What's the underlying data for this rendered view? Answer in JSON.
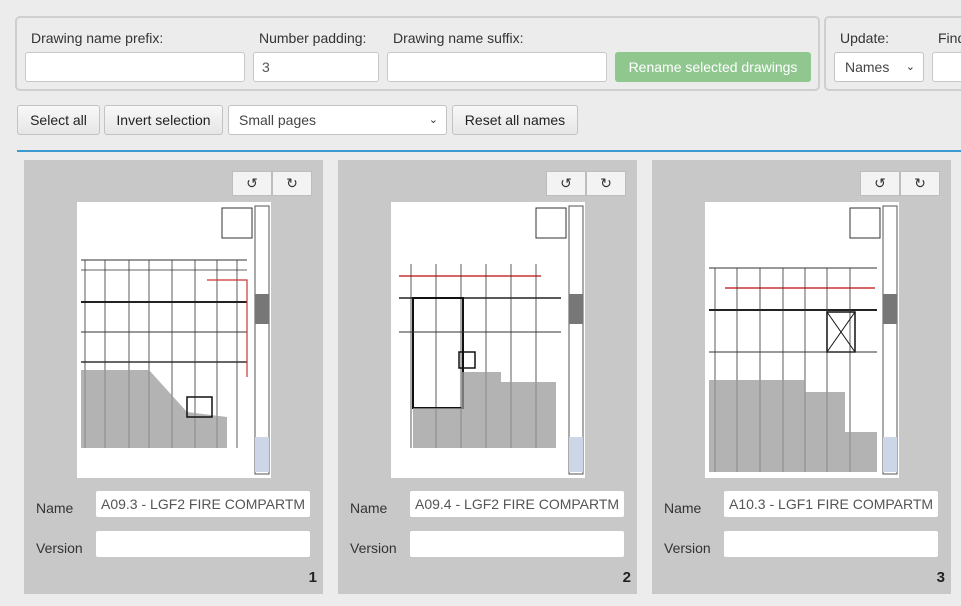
{
  "rename_panel": {
    "prefix_label": "Drawing name prefix:",
    "prefix_value": "",
    "padding_label": "Number padding:",
    "padding_value": "3",
    "suffix_label": "Drawing name suffix:",
    "suffix_value": "",
    "rename_button": "Rename selected drawings"
  },
  "update_panel": {
    "update_label": "Update:",
    "update_selected": "Names",
    "find_label": "Find",
    "find_value": ""
  },
  "toolbar": {
    "select_all": "Select all",
    "invert_selection": "Invert selection",
    "page_size_selected": "Small pages",
    "reset_names": "Reset all names"
  },
  "cards": [
    {
      "name_label": "Name",
      "name_value": "A09.3 - LGF2 FIRE COMPARTM",
      "version_label": "Version",
      "version_value": "",
      "number": "1"
    },
    {
      "name_label": "Name",
      "name_value": "A09.4 - LGF2 FIRE COMPARTM",
      "version_label": "Version",
      "version_value": "",
      "number": "2"
    },
    {
      "name_label": "Name",
      "name_value": "A10.3 - LGF1 FIRE COMPARTM",
      "version_label": "Version",
      "version_value": "",
      "number": "3"
    }
  ],
  "icons": {
    "rotate_left": "rotate-ccw-icon",
    "rotate_right": "rotate-cw-icon",
    "dropdown": "chevron-down-icon"
  },
  "colors": {
    "accent_line": "#3d9ad1",
    "rename_button": "#8fc78f",
    "card_background": "#c8c8c8"
  }
}
